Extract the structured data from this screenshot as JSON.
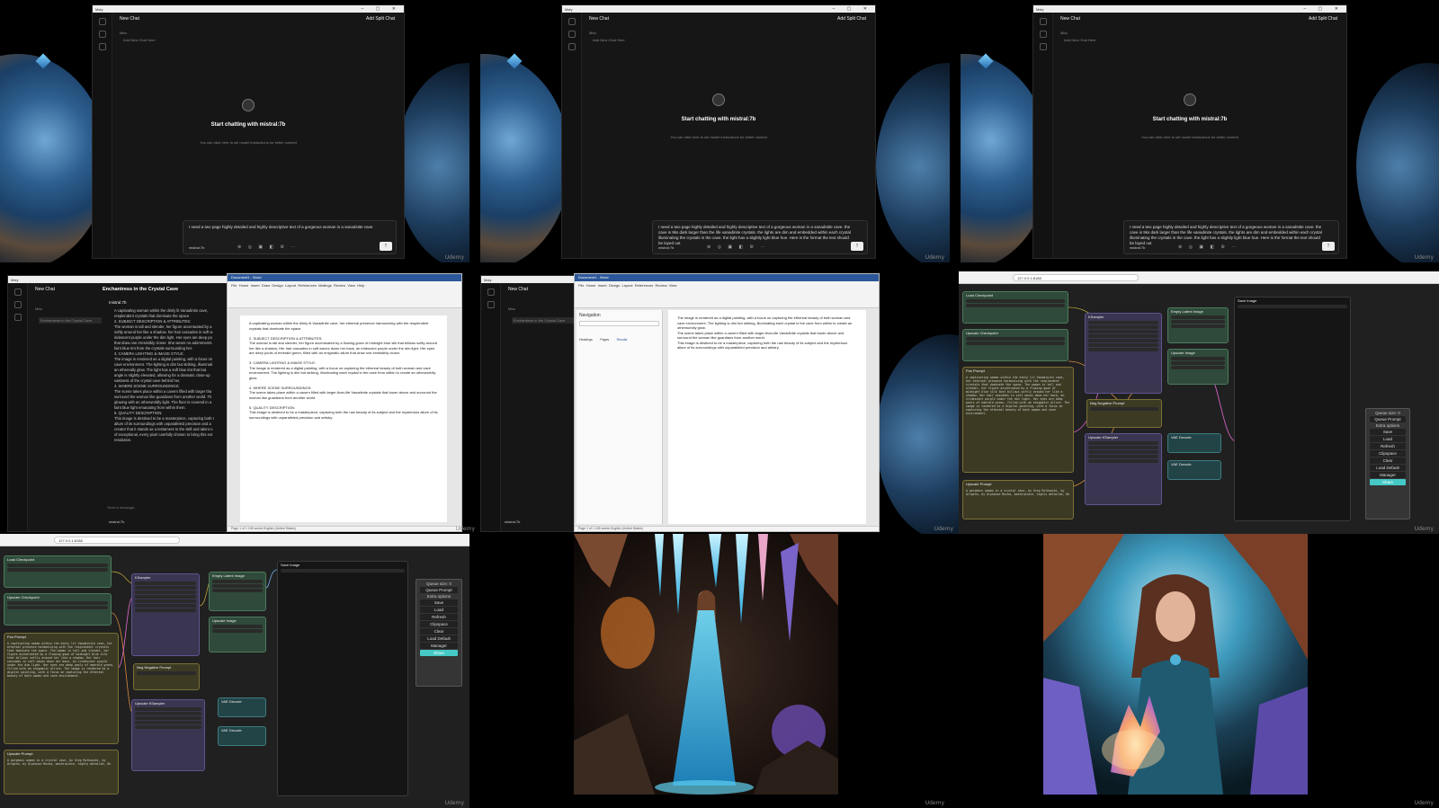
{
  "watermark": "Udemy",
  "chat": {
    "window_title": "Msty",
    "new_chat": "New Chat",
    "split_chat": "Add Split Chat",
    "folder": "Misc",
    "first_chat": "Add New Chat Here",
    "start_text": "Start chatting with mistral:7b",
    "hint_text": "You can click here to set model instructions for better context",
    "model": "mistral:7b",
    "prompt_short": "I need a two page highly detailed and highly descriptive text of a gorgeous woman in a sanadstite cave",
    "prompt_long": "I need a two page highly detailed and highly descriptive text of a gorgeous woman in a sanadstite cave. the cave is 9ks dark larger than the life vanadinite crystals. the lights are dim and embedded within each crystal illuminating the crystals in the cave. the light has a slightly light blue hue. Here is the format the text should be layed out",
    "send_placeholder": "Send a message..."
  },
  "transcript": {
    "title": "Enchantress in the Crystal Cave",
    "model": "mistral:7b",
    "folder": "Misc",
    "chat_item": "Enchantress in the Crystal Cave",
    "lines": [
      "A captivating woman within the dimly lit Vanadinite cave,",
      "resplendent crystals that dominate the space.",
      "2. SUBJECT DESCRIPTION & ATTRIBUTES:",
      "The woman is tall and slender, her figure accentuated by a",
      "softly around her like a shadow. her hair cascades in soft w",
      "iridescent purple under the dim light. Her eyes are deep po",
      "that draw one irresistibly closer. She wears no adornments",
      "faint blue tint from the crystals surrounding her.",
      "3. CAMERA LIGHTING & IMAGE STYLE:",
      "The image is rendered as a digital painting, with a focus on",
      "cave environment. The lighting is dim but striking, illuminati",
      "an ethereally glow. The light has a soft blue tint that bat",
      "angle is slightly elevated, allowing for a dramatic close-up",
      "vastness of the crystal cave behind her.",
      "4. WHERE SCENE SURROUNDINGS:",
      "The scene takes place within a cavern filled with larger tha",
      "surround the woman like guardians from another world. Th",
      "glowing with an otherworldly light. The floor is covered in a",
      "faint blue light emanating from within them.",
      "5. QUALITY DESCRIPTION:",
      "This image is destined to be a masterpiece, capturing both t",
      "allure of its surroundings with unparalleled precision and a",
      "creator that it stands as a testament to the skill and talent o",
      "of exceptional, every pixel carefully chosen to bring this ext",
      "resolution."
    ]
  },
  "word": {
    "doc_title": "Document1 - Word",
    "tabs": [
      "File",
      "Home",
      "Insert",
      "Draw",
      "Design",
      "Layout",
      "References",
      "Mailings",
      "Review",
      "View",
      "Help"
    ],
    "status": "Page 1 of 1   245 words   English (United States)",
    "navigation": "Navigation",
    "nav_tabs": [
      "Headings",
      "Pages",
      "Results"
    ],
    "paragraphs": [
      "A captivating woman within the dimly lit Vanadinite cave, her ethereal presence harmonizing with the resplendent crystals that dominate the space.",
      "2. SUBJECT DESCRIPTION & ATTRIBUTES:",
      "The woman is tall and slender, her figure accentuated by a flowing gown of midnight blue silk that billows softly around her like a shadow. Her hair cascades in soft waves down her back, an iridescent purple under the dim light. Her eyes are deep pools of emerald green, filled with an enigmatic allure that draw one irresistibly closer.",
      "3. CAMERA LIGHTING & IMAGE STYLE:",
      "The image is rendered as a digital painting, with a focus on capturing the ethereal beauty of both woman and cave environment. The lighting is dim but striking, illuminating each crystal in the cave from within to create an otherworldly glow.",
      "4. WHERE SCENE SURROUNDINGS:",
      "The scene takes place within a cavern filled with larger-than-life Vanadinite crystals that tower above and surround the woman like guardians from another world.",
      "5. QUALITY DESCRIPTION:",
      "This image is destined to be a masterpiece, capturing both the raw beauty of its subject and the mysterious allure of its surroundings with unparalleled precision and artistry."
    ]
  },
  "nodes": {
    "url": "127.0.0.1:8188",
    "titles": {
      "checkpoint": "Load Checkpoint",
      "upscale_ckpt": "Upscale Checkpoint",
      "pos_prompt": "Pos Prompt",
      "neg_prompt": "Neg Negative Prompt",
      "sampler": "KSampler",
      "latent": "Empty Latent Image",
      "upscale_sampler": "Upscale KSampler",
      "vae": "VAE Decode",
      "save": "Save Image",
      "upscale": "Upscale Image",
      "upscale_prompt": "Upscale Prompt"
    },
    "prompt_text": "A captivating woman within the dimly lit Vanadinite cave, her ethereal presence harmonizing with the resplendent crystals that dominate the space. The woman is tall and slender, her figure accentuated by a flowing gown of midnight blue silk that billows softly around her like a shadow. Her hair cascades in soft waves down her back, an iridescent purple under the dim light. Her eyes are deep pools of emerald green, filled with an enigmatic allure. The image is rendered as a digital painting, with a focus on capturing the ethereal beauty of both woman and cave environment.",
    "upscale_prompt_text": "A gorgeous woman in a crystal cave, by Greg Rutkowski, by Artgerm, by Alphonse Mucha, masterpiece, highly detailed, 8k",
    "panel": {
      "queue_size": "Queue size: 0",
      "queue_prompt": "Queue Prompt",
      "extra_options": "Extra options",
      "save": "Save",
      "load": "Load",
      "refresh": "Refresh",
      "clipspace": "Clipspace",
      "clear": "Clear",
      "load_default": "Load Default",
      "manager": "Manager",
      "share": "Share"
    }
  },
  "colors": {
    "share": "#45c9c6",
    "word_blue": "#2b579a",
    "node_green": "#2f4a3a",
    "node_purple": "#3a3550",
    "node_olive": "#3d3a24"
  },
  "icons": [
    "app-logo-icon",
    "new-chat-icon",
    "search-icon",
    "settings-icon",
    "send-arrow-icon",
    "attach-icon",
    "folder-icon",
    "close-icon",
    "minimize-icon",
    "maximize-icon"
  ]
}
